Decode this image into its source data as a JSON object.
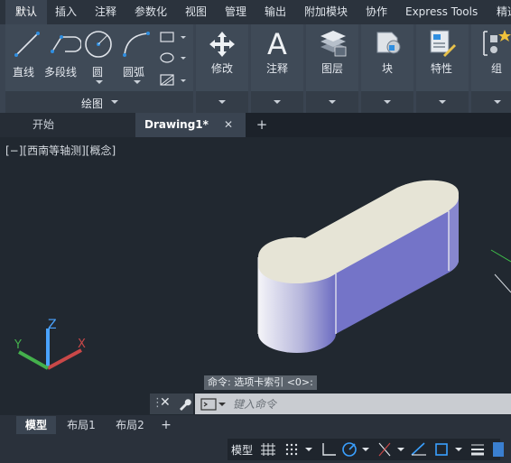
{
  "ribbon_tabs": [
    "默认",
    "插入",
    "注释",
    "参数化",
    "视图",
    "管理",
    "输出",
    "附加模块",
    "协作",
    "Express Tools",
    "精选"
  ],
  "ribbon": {
    "draw_tools": {
      "line": "直线",
      "polyline": "多段线",
      "circle": "圆",
      "arc": "圆弧"
    },
    "draw_panel_title": "绘图",
    "modify": "修改",
    "annotate": "注释",
    "layers": "图层",
    "block": "块",
    "properties": "特性",
    "group": "组"
  },
  "doc_tabs": {
    "start": "开始",
    "drawing": "Drawing1*",
    "close": "✕",
    "add": "+"
  },
  "viewport": {
    "label": "[−][西南等轴测][概念]",
    "ucs": {
      "z": "Z",
      "y": "Y",
      "x": "X"
    }
  },
  "command": {
    "history": "命令:  选项卡索引 <0>:",
    "placeholder": "键入命令"
  },
  "layout_tabs": [
    "模型",
    "布局1",
    "布局2"
  ],
  "layout_add": "+",
  "status": {
    "model": "模型"
  },
  "colors": {
    "accent": "#2f8ee0",
    "shape_top": "#e6e4d6",
    "shape_side": "#7272c4"
  }
}
